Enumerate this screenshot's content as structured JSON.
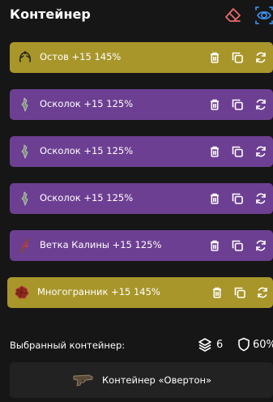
{
  "header": {
    "title": "Контейнер"
  },
  "items": [
    {
      "label": "Остов +15 145%",
      "color": "#a8962b",
      "icon": "ostov-icon"
    },
    {
      "label": "Осколок +15 125%",
      "color": "#6d3f92",
      "icon": "shard-icon"
    },
    {
      "label": "Осколок +15 125%",
      "color": "#6d3f92",
      "icon": "shard-icon"
    },
    {
      "label": "Осколок +15 125%",
      "color": "#6d3f92",
      "icon": "shard-icon"
    },
    {
      "label": "Ветка Калины +15 125%",
      "color": "#6d3f92",
      "icon": "viburnum-branch-icon"
    },
    {
      "label": "Многогранник +15 145%",
      "color": "#a8962b",
      "icon": "polyhedron-icon"
    }
  ],
  "footer": {
    "selected_label": "Выбранный контейнер:",
    "layers_count": "6",
    "shield_percent": "60%",
    "container_name": "Контейнер «Овертон»"
  },
  "colors": {
    "background": "#161616",
    "gold": "#a8962b",
    "purple": "#6d3f92",
    "eraser": "#e86a6a",
    "eye": "#3b8fe8",
    "button_bg": "#222222"
  }
}
